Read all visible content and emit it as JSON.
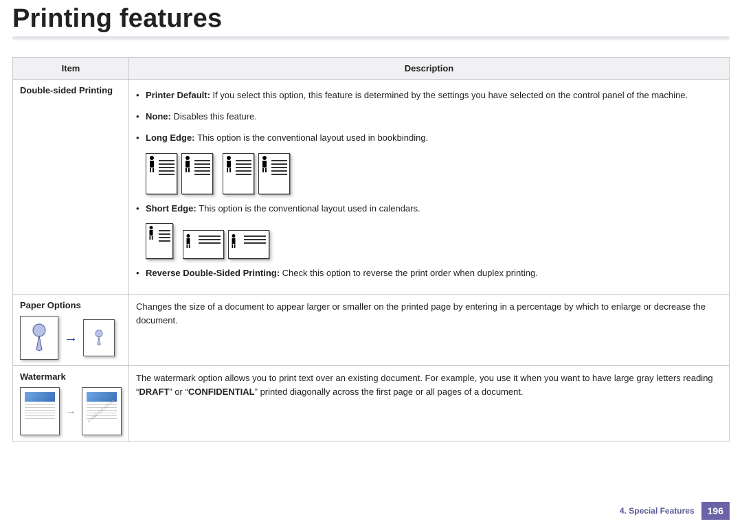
{
  "title": "Printing features",
  "table": {
    "headers": {
      "item": "Item",
      "description": "Description"
    },
    "rows": {
      "double_sided": {
        "label": "Double-sided Printing",
        "bullets": {
          "printer_default": {
            "term": "Printer Default: ",
            "text": "If you select this option, this feature is determined by the settings you have selected on the control panel of the machine."
          },
          "none": {
            "term": "None: ",
            "text": "Disables this feature."
          },
          "long_edge": {
            "term": "Long Edge: ",
            "text": "This option is the conventional layout used in bookbinding."
          },
          "short_edge": {
            "term": "Short Edge: ",
            "text": "This option is the conventional layout used in calendars."
          },
          "reverse": {
            "term": "Reverse Double-Sided Printing: ",
            "text": "Check this option to reverse the print order when duplex printing."
          }
        }
      },
      "paper_options": {
        "label": "Paper Options",
        "text": "Changes the size of a document to appear larger or smaller on the printed page by entering in a percentage by which to enlarge or decrease the document."
      },
      "watermark": {
        "label": "Watermark",
        "text_pre": "The watermark option allows you to print text over an existing document. For example, you use it when you want to have large gray letters reading “",
        "draft": "DRAFT",
        "text_mid": "” or “",
        "confidential": "CONFIDENTIAL",
        "text_post": "” printed diagonally across the first page or all pages of a document.",
        "diag_label": "CONFIDENTIAL"
      }
    }
  },
  "footer": {
    "chapter": "4.  Special Features",
    "page": "196"
  }
}
